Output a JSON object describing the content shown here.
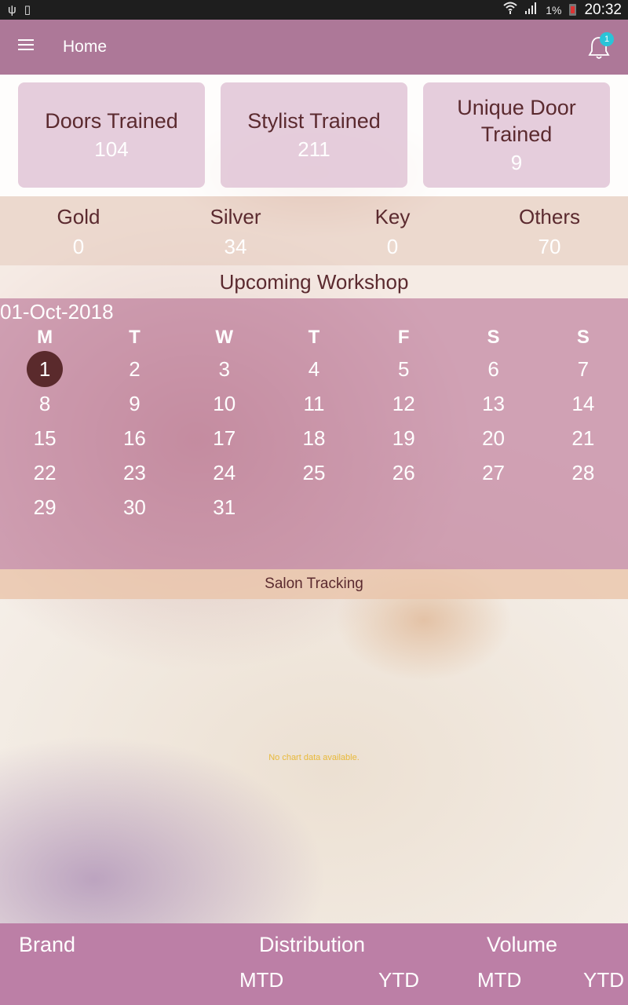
{
  "status_bar": {
    "left_icons": [
      "usb-icon",
      "no-sim-icon"
    ],
    "battery_percent": "1%",
    "time": "20:32"
  },
  "app_bar": {
    "title": "Home",
    "notification_count": "1"
  },
  "stats": [
    {
      "label": "Doors Trained",
      "value": "104"
    },
    {
      "label": "Stylist Trained",
      "value": "211"
    },
    {
      "label": "Unique Door Trained",
      "value": "9"
    }
  ],
  "tiers": [
    {
      "label": "Gold",
      "value": "0"
    },
    {
      "label": "Silver",
      "value": "34"
    },
    {
      "label": "Key",
      "value": "0"
    },
    {
      "label": "Others",
      "value": "70"
    }
  ],
  "workshop": {
    "title": "Upcoming Workshop",
    "date": "01-Oct-2018",
    "weekdays": [
      "M",
      "T",
      "W",
      "T",
      "F",
      "S",
      "S"
    ],
    "weeks": [
      [
        "1",
        "2",
        "3",
        "4",
        "5",
        "6",
        "7"
      ],
      [
        "8",
        "9",
        "10",
        "11",
        "12",
        "13",
        "14"
      ],
      [
        "15",
        "16",
        "17",
        "18",
        "19",
        "20",
        "21"
      ],
      [
        "22",
        "23",
        "24",
        "25",
        "26",
        "27",
        "28"
      ],
      [
        "29",
        "30",
        "31",
        "",
        "",
        "",
        ""
      ]
    ],
    "selected_day": "1"
  },
  "salon_tracking": {
    "title": "Salon Tracking",
    "empty_message": "No chart data available."
  },
  "table": {
    "brand": "Brand",
    "distribution": "Distribution",
    "volume": "Volume",
    "mtd": "MTD",
    "ytd": "YTD"
  },
  "colors": {
    "app_bar": "#ad7898",
    "table_header": "#bc7fa6",
    "selected_day": "#5a2a2c",
    "badge": "#29c4d8",
    "label_text": "#5b2a2f",
    "empty_message": "#e8b93a"
  }
}
